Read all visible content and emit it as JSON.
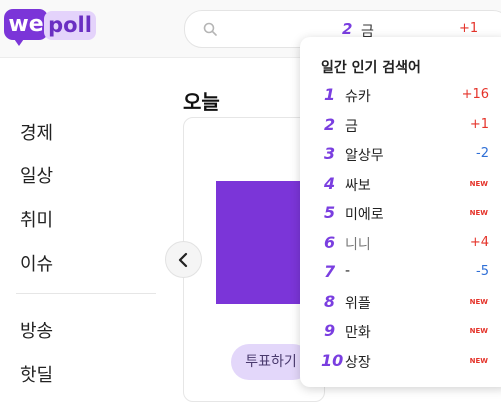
{
  "header": {
    "logo": {
      "part1": "we",
      "part2": "poll"
    },
    "search": {
      "rank": "2",
      "keyword": "금",
      "change": "+1"
    }
  },
  "sidebar": {
    "items": [
      {
        "label": "경제"
      },
      {
        "label": "일상"
      },
      {
        "label": "취미"
      },
      {
        "label": "이슈"
      },
      {
        "label": "방송"
      },
      {
        "label": "핫딜"
      }
    ]
  },
  "main": {
    "heading": "오늘",
    "vote_button": "투표하기"
  },
  "trending": {
    "title": "일간 인기 검색어",
    "items": [
      {
        "rank": "1",
        "keyword": "슈카",
        "change": "+16"
      },
      {
        "rank": "2",
        "keyword": "금",
        "change": "+1"
      },
      {
        "rank": "3",
        "keyword": "알상무",
        "change": "-2"
      },
      {
        "rank": "4",
        "keyword": "싸보",
        "change": "NEW"
      },
      {
        "rank": "5",
        "keyword": "미에로",
        "change": "NEW"
      },
      {
        "rank": "6",
        "keyword": "니니",
        "change": "+4"
      },
      {
        "rank": "7",
        "keyword": "-",
        "change": "-5"
      },
      {
        "rank": "8",
        "keyword": "위플",
        "change": "NEW"
      },
      {
        "rank": "9",
        "keyword": "만화",
        "change": "NEW"
      },
      {
        "rank": "10",
        "keyword": "상장",
        "change": "NEW"
      }
    ]
  },
  "colors": {
    "brand": "#7b35d8",
    "up": "#e5332a",
    "down": "#2f6fd6",
    "new": "#e5332a"
  }
}
